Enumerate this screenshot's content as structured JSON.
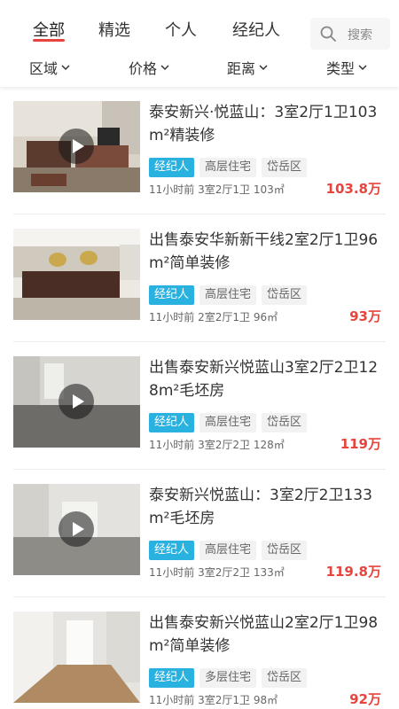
{
  "tabs": [
    {
      "label": "全部",
      "active": true
    },
    {
      "label": "精选",
      "active": false
    },
    {
      "label": "个人",
      "active": false
    },
    {
      "label": "经纪人",
      "active": false
    }
  ],
  "search": {
    "label": "搜索",
    "icon": "search-icon"
  },
  "filters": [
    {
      "label": "区域",
      "icon": "chevron-down-icon"
    },
    {
      "label": "价格",
      "icon": "chevron-down-icon"
    },
    {
      "label": "距离",
      "icon": "chevron-down-icon"
    },
    {
      "label": "类型",
      "icon": "chevron-down-icon"
    }
  ],
  "colors": {
    "accent": "#e5453d",
    "agent_tag": "#29b1e0",
    "price": "#e5453d"
  },
  "listings": [
    {
      "title": "泰安新兴·悦蓝山：3室2厅1卫103m²精装修",
      "tags": [
        "经纪人",
        "高层住宅",
        "岱岳区"
      ],
      "time": "11小时前",
      "layout": "3室2厅1卫",
      "area": "103㎡",
      "price": "103.8万",
      "has_video": true
    },
    {
      "title": "出售泰安华新新干线2室2厅1卫96m²简单装修",
      "tags": [
        "经纪人",
        "高层住宅",
        "岱岳区"
      ],
      "time": "11小时前",
      "layout": "2室2厅1卫",
      "area": "96㎡",
      "price": "93万",
      "has_video": false
    },
    {
      "title": "出售泰安新兴悦蓝山3室2厅2卫128m²毛坯房",
      "tags": [
        "经纪人",
        "高层住宅",
        "岱岳区"
      ],
      "time": "11小时前",
      "layout": "3室2厅2卫",
      "area": "128㎡",
      "price": "119万",
      "has_video": true
    },
    {
      "title": "泰安新兴悦蓝山：3室2厅2卫133m²毛坯房",
      "tags": [
        "经纪人",
        "高层住宅",
        "岱岳区"
      ],
      "time": "11小时前",
      "layout": "3室2厅2卫",
      "area": "133㎡",
      "price": "119.8万",
      "has_video": true
    },
    {
      "title": "出售泰安新兴悦蓝山2室2厅1卫98m²简单装修",
      "tags": [
        "经纪人",
        "多层住宅",
        "岱岳区"
      ],
      "time": "11小时前",
      "layout": "3室2厅1卫",
      "area": "98㎡",
      "price": "92万",
      "has_video": false
    }
  ]
}
